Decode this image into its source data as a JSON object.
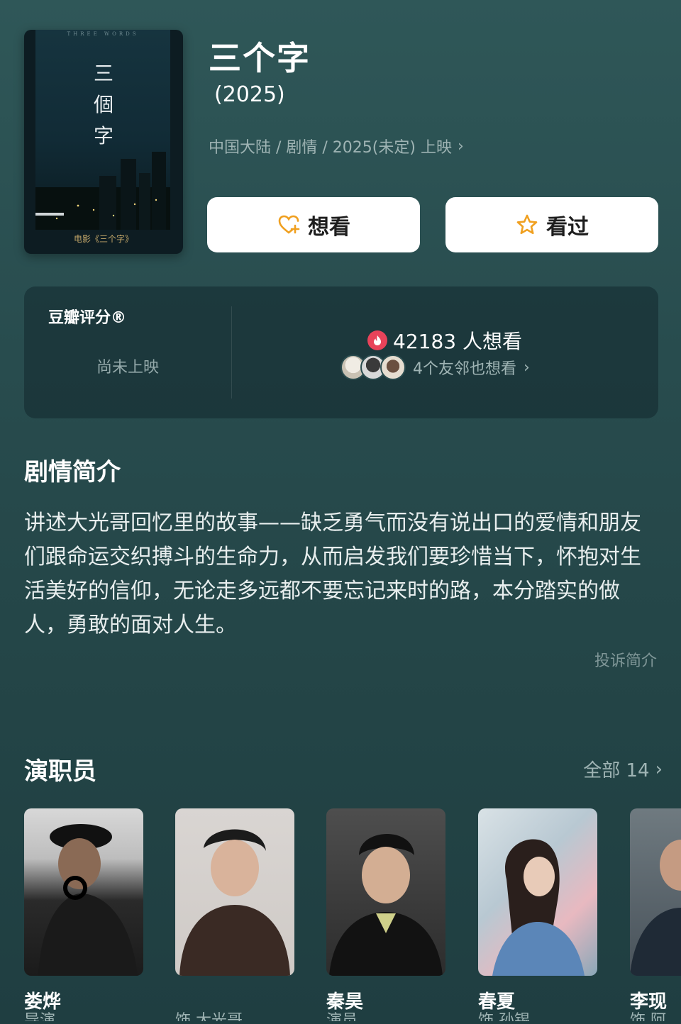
{
  "movie": {
    "title": "三个字",
    "year": "(2025)",
    "meta": "中国大陆 / 剧情 / 2025(未定) 上映",
    "poster": {
      "tag": "THREE WORDS",
      "title": "三個字",
      "caption": "电影《三个字》"
    }
  },
  "actions": {
    "want_label": "想看",
    "watched_label": "看过"
  },
  "rating": {
    "label": "豆瓣评分®",
    "status": "尚未上映",
    "want_count": "42183 人想看",
    "friends_text": "4个友邻也想看"
  },
  "synopsis": {
    "heading": "剧情简介",
    "text": "讲述大光哥回忆里的故事——缺乏勇气而没有说出口的爱情和朋友们跟命运交织搏斗的生命力，从而启发我们要珍惜当下，怀抱对生活美好的信仰，无论走多远都不要忘记来时的路，本分踏实的做人，勇敢的面对人生。",
    "report": "投诉简介"
  },
  "cast": {
    "heading": "演职员",
    "all_label": "全部 14",
    "members": [
      {
        "name": "娄烨",
        "role": "导演"
      },
      {
        "name": "",
        "role": "饰 大光哥"
      },
      {
        "name": "秦昊",
        "role": "演员"
      },
      {
        "name": "春夏",
        "role": "饰 孙锡"
      },
      {
        "name": "李现",
        "role": "饰 阿晖"
      }
    ]
  },
  "colors": {
    "background": "#2a4f51",
    "card": "#1d3a3f",
    "accent_orange": "#f0a020",
    "flame_red": "#e8435a"
  }
}
